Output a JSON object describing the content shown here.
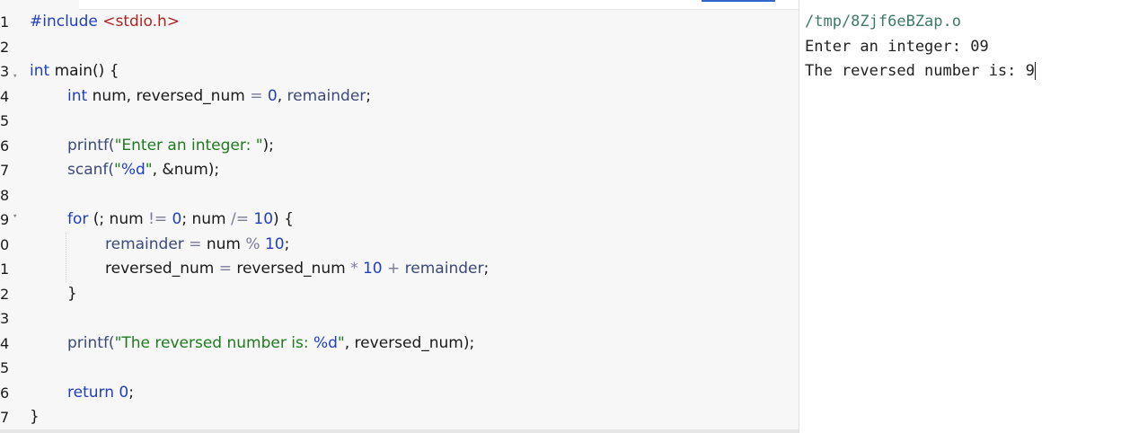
{
  "editor": {
    "line_numbers": [
      "1",
      "2",
      "3",
      "4",
      "5",
      "6",
      "7",
      "8",
      "9",
      "0",
      "1",
      "2",
      "3",
      "4",
      "5",
      "6",
      "7"
    ],
    "code": {
      "l1_directive": "#include",
      "l1_header": "<stdio.h>",
      "l3_type": "int",
      "l3_rest": " main() {",
      "l4_type": "int",
      "l4_a": " num, reversed_num ",
      "l4_eq": "=",
      "l4_zero": "0",
      "l4_comma": ", ",
      "l4_rem": "remainder",
      "l4_end": ";",
      "l6_fn": "printf(",
      "l6_str": "\"Enter an integer: \"",
      "l6_end": ");",
      "l7_fn": "scanf(",
      "l7_q1": "\"",
      "l7_fmt": "%d",
      "l7_q2": "\"",
      "l7_rest": ", &num);",
      "l9_kw": "for",
      "l9_a": " (; num ",
      "l9_ne": "!=",
      "l9_sp": " ",
      "l9_zero": "0",
      "l9_b": "; num ",
      "l9_div": "/=",
      "l9_sp2": " ",
      "l9_ten": "10",
      "l9_c": ") {",
      "l10_var": "remainder",
      "l10_eq": " = ",
      "l10_num": "num ",
      "l10_mod": "%",
      "l10_sp": " ",
      "l10_ten": "10",
      "l10_end": ";",
      "l11_a": "reversed_num ",
      "l11_eq": "=",
      "l11_b": " reversed_num ",
      "l11_mul": "*",
      "l11_sp": " ",
      "l11_ten": "10",
      "l11_plus": " + ",
      "l11_rem": "remainder",
      "l11_end": ";",
      "l12_close": "}",
      "l14_fn": "printf(",
      "l14_str": "\"The reversed number is: ",
      "l14_fmt": "%d",
      "l14_q": "\"",
      "l14_rest": ", reversed_num);",
      "l16_kw": "return",
      "l16_sp": " ",
      "l16_zero": "0",
      "l16_end": ";",
      "l17_close": "}"
    }
  },
  "output": {
    "path": "/tmp/8Zjf6eBZap.o",
    "line2": "Enter an integer: 09",
    "line3": "The reversed number is: 9"
  },
  "colors": {
    "keyword": "#1f3fbf",
    "string": "#1f7a1f",
    "include_header": "#b22222",
    "output_path": "#3d7a6a"
  }
}
